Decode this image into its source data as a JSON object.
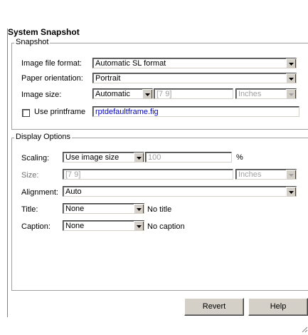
{
  "title": "System Snapshot",
  "snapshot": {
    "legend": "Snapshot",
    "image_format_label": "Image file format:",
    "image_format_value": "Automatic SL format",
    "paper_orientation_label": "Paper orientation:",
    "paper_orientation_value": "Portrait",
    "image_size_label": "Image size:",
    "image_size_mode": "Automatic",
    "image_size_value": "[7 9]",
    "image_size_units": "Inches",
    "use_printframe_label": "Use printframe",
    "use_printframe_checked": false,
    "printframe_file": "rptdefaultframe.fig"
  },
  "display": {
    "legend": "Display Options",
    "scaling_label": "Scaling:",
    "scaling_mode": "Use image size",
    "scaling_value": "100",
    "scaling_unit": "%",
    "size_label": "Size:",
    "size_value": "[7 9]",
    "size_units": "Inches",
    "alignment_label": "Alignment:",
    "alignment_value": "Auto",
    "title_label": "Title:",
    "title_value": "None",
    "title_preview": "No title",
    "caption_label": "Caption:",
    "caption_value": "None",
    "caption_preview": "No caption"
  },
  "buttons": {
    "revert": "Revert",
    "help": "Help"
  },
  "colors": {
    "link_text": "#0000c8",
    "disabled_text": "#a0a0a0"
  },
  "icons": {
    "dropdown": "chevron-down-icon",
    "resize": "resize-grip-icon"
  }
}
